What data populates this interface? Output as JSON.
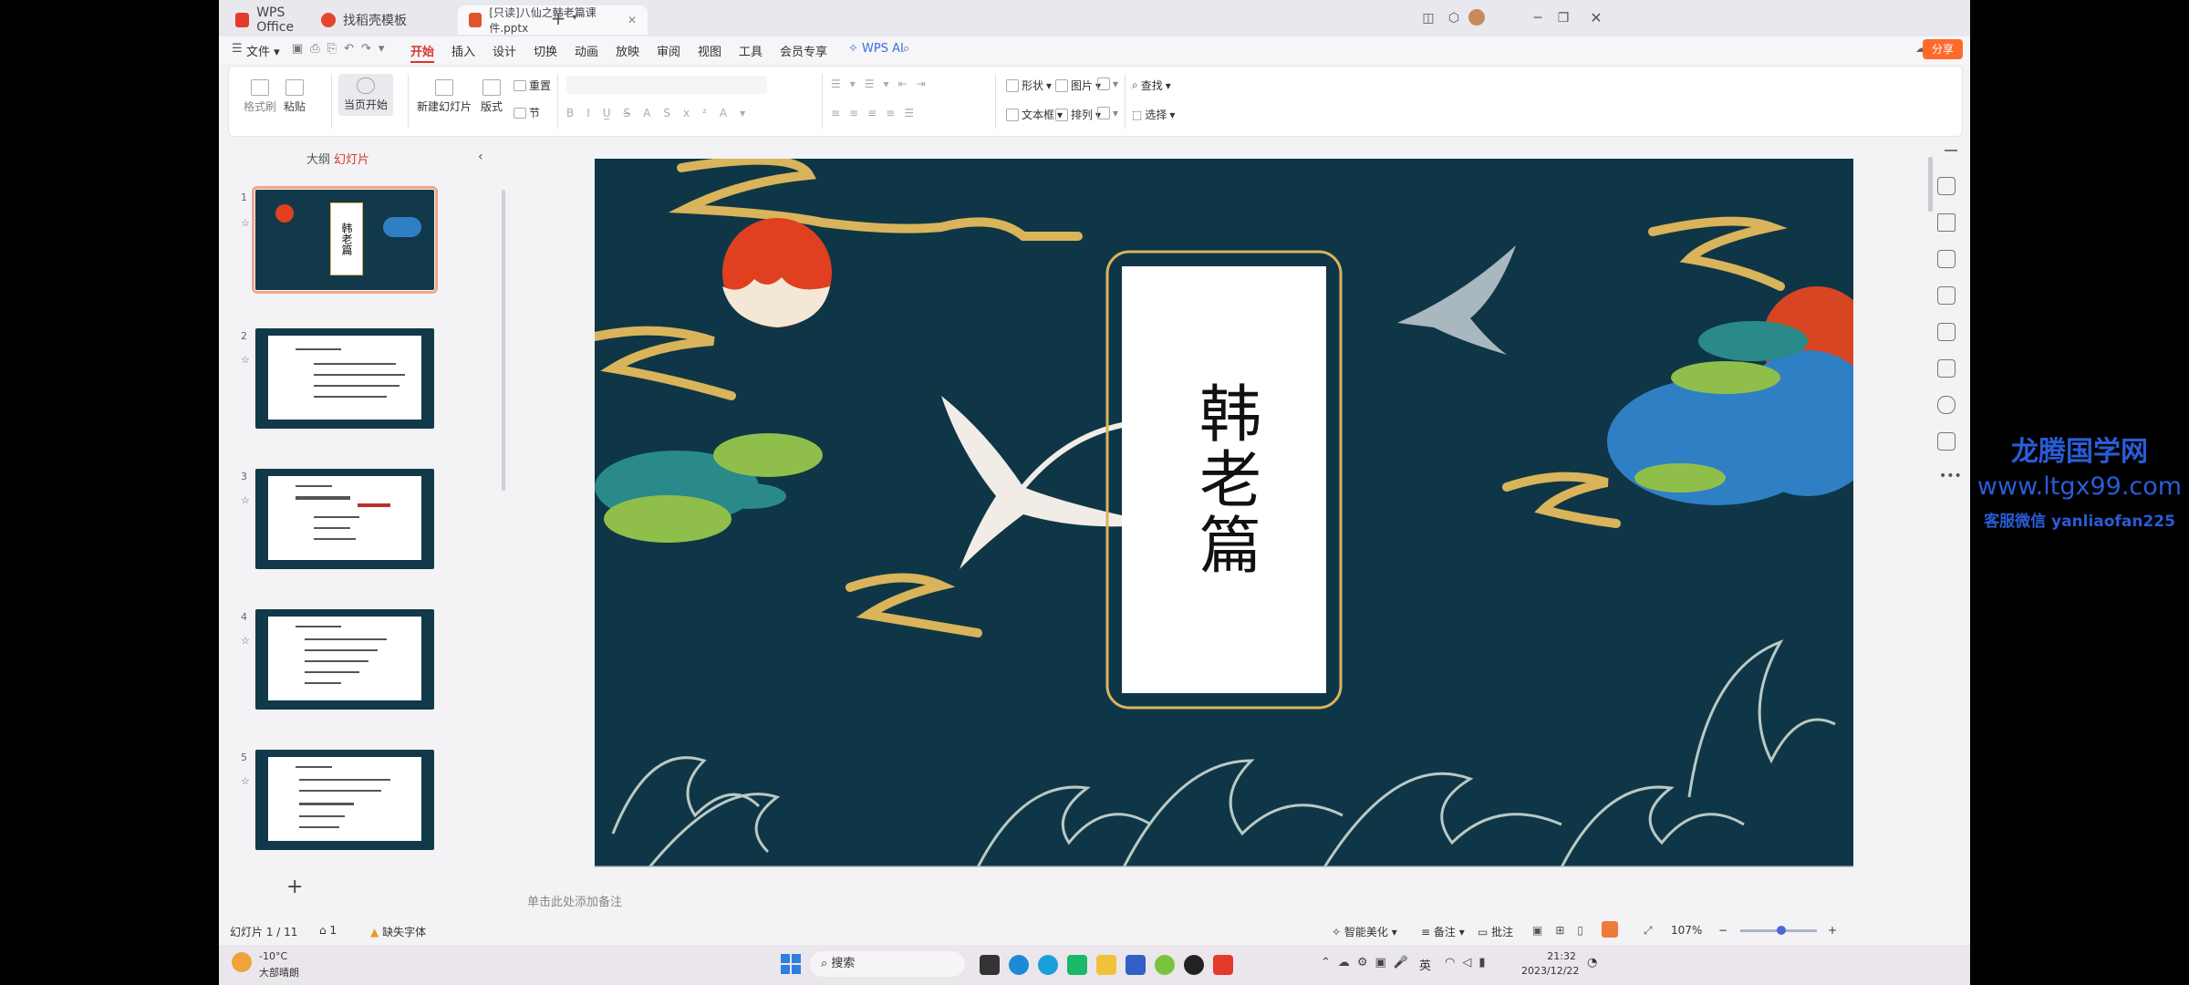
{
  "tabs": [
    {
      "label": "WPS Office",
      "active": false
    },
    {
      "label": "找稻壳模板",
      "active": false
    },
    {
      "label": "[只读]八仙之韩老篇课件.pptx",
      "active": true
    }
  ],
  "menubar": {
    "file": "文件",
    "items": [
      "开始",
      "插入",
      "设计",
      "切换",
      "动画",
      "放映",
      "审阅",
      "视图",
      "工具",
      "会员专享"
    ],
    "active": "开始",
    "wps_ai": "WPS AI",
    "share": "分享"
  },
  "ribbon": {
    "format_painter": "格式刷",
    "paste": "粘贴",
    "play_from_current": "当页开始",
    "new_slide": "新建幻灯片",
    "layout": "版式",
    "reset": "重置",
    "section": "节",
    "shape": "形状",
    "picture": "图片",
    "textbox": "文本框",
    "arrange": "排列",
    "find": "查找",
    "select": "选择"
  },
  "left_panel": {
    "tab_outline": "大纲",
    "tab_slides": "幻灯片",
    "thumbnails": [
      {
        "number": "1",
        "selected": true,
        "title": "韩老篇"
      },
      {
        "number": "2",
        "selected": false
      },
      {
        "number": "3",
        "selected": false
      },
      {
        "number": "4",
        "selected": false
      },
      {
        "number": "5",
        "selected": false
      }
    ],
    "add": "+"
  },
  "slide": {
    "title": "韩老篇",
    "colors": {
      "background": "#0f3646",
      "gold": "#d9b45a",
      "sun": "#e0401f",
      "cloud_blue": "#2f7fc4",
      "pine_green": "#8fbf4a"
    }
  },
  "notes_placeholder": "单击此处添加备注",
  "status": {
    "slide_counter": "幻灯片 1 / 11",
    "comments": "1",
    "missing_font": "缺失字体",
    "smart_beautify": "智能美化",
    "notes": "备注",
    "comment": "批注",
    "zoom": "107%"
  },
  "taskbar": {
    "weather_temp": "-10°C",
    "weather_desc": "大部晴朗",
    "search": "搜索",
    "time": "21:32",
    "date": "2023/12/22",
    "ime": "英"
  },
  "watermark": {
    "name": "龙腾国学网",
    "url": "www.ltgx99.com",
    "contact": "客服微信 yanliaofan225"
  }
}
